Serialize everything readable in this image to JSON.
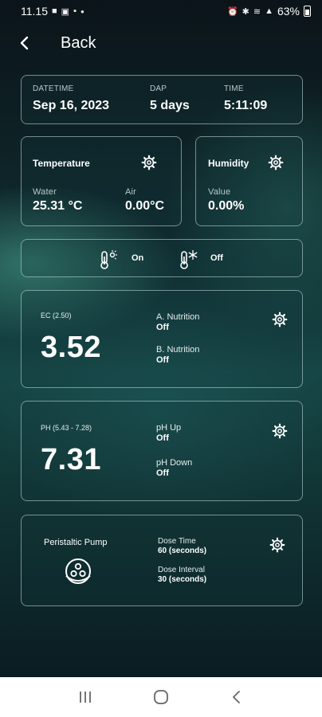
{
  "status_bar": {
    "time": "11.15",
    "battery": "63%"
  },
  "header": {
    "back_label": "Back"
  },
  "datetime_card": {
    "datetime_label": "DATETIME",
    "datetime_value": "Sep 16, 2023",
    "dap_label": "DAP",
    "dap_value": "5 days",
    "time_label": "TIME",
    "time_value": "5:11:09"
  },
  "temperature_card": {
    "title": "Temperature",
    "water_label": "Water",
    "water_value": "25.31 °C",
    "air_label": "Air",
    "air_value": "0.00°C"
  },
  "humidity_card": {
    "title": "Humidity",
    "value_label": "Value",
    "value": "0.00%"
  },
  "heater_cooler": {
    "heater_state": "On",
    "cooler_state": "Off"
  },
  "ec_card": {
    "range_label": "EC (2.50)",
    "value": "3.52",
    "a_label": "A. Nutrition",
    "a_state": "Off",
    "b_label": "B. Nutrition",
    "b_state": "Off"
  },
  "ph_card": {
    "range_label": "PH (5.43 - 7.28)",
    "value": "7.31",
    "up_label": "pH Up",
    "up_state": "Off",
    "down_label": "pH Down",
    "down_state": "Off"
  },
  "pump_card": {
    "title": "Peristaltic Pump",
    "dose_time_label": "Dose Time",
    "dose_time_value": "60 (seconds)",
    "dose_interval_label": "Dose Interval",
    "dose_interval_value": "30 (seconds)"
  },
  "icons": {
    "back": "arrow-left-icon",
    "gear": "gear-icon",
    "heater": "thermometer-sun-icon",
    "cooler": "thermometer-snow-icon",
    "pump": "peristaltic-pump-icon"
  },
  "colors": {
    "card_border": "#c8e1e1",
    "label": "#b9c9ca",
    "nav_bg": "#ffffff"
  }
}
